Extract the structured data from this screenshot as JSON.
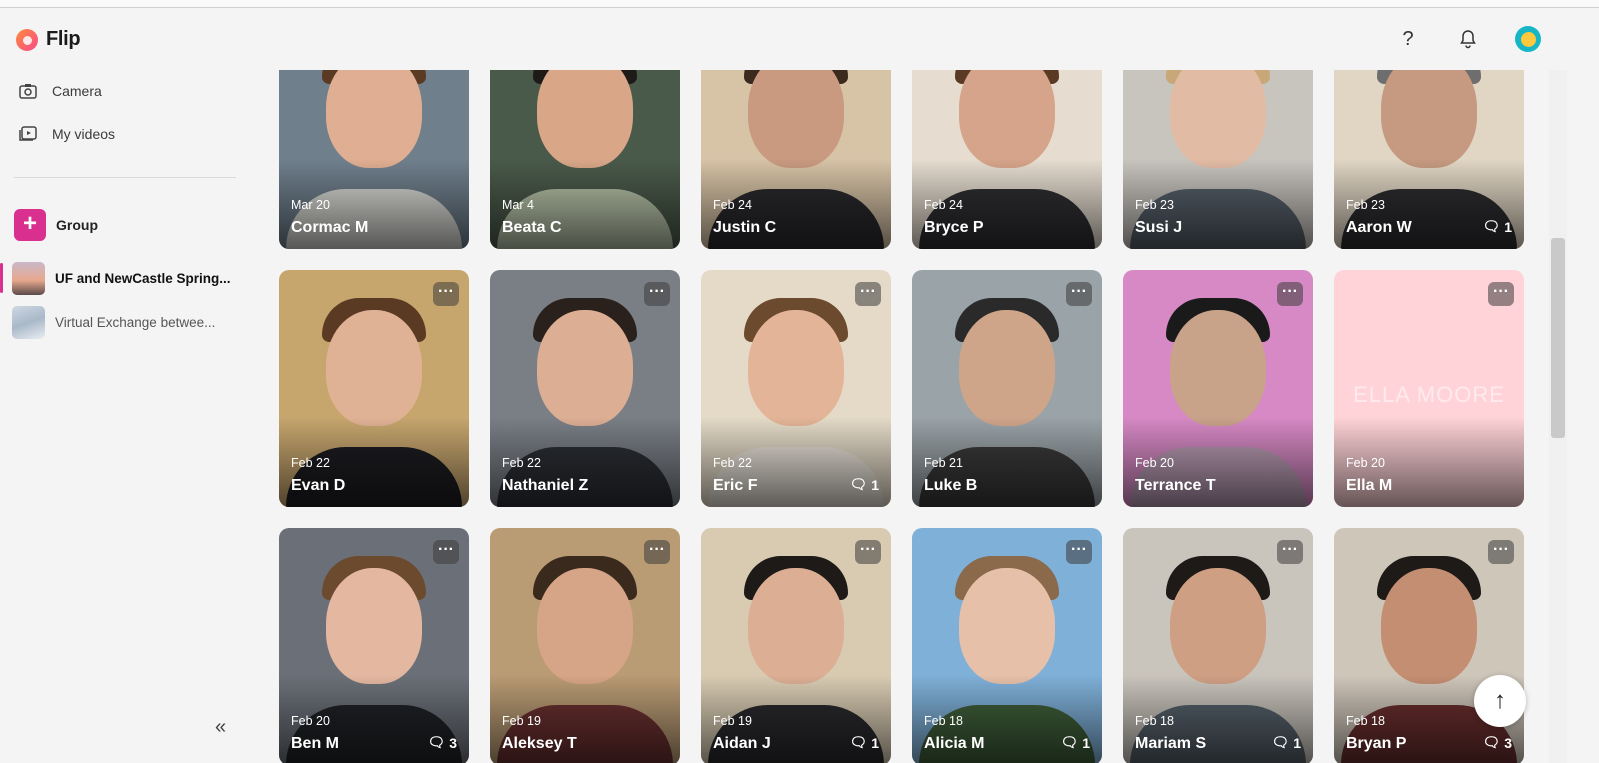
{
  "app": {
    "name": "Flip"
  },
  "header": {
    "help_icon": "question-mark-icon",
    "notifications_icon": "bell-icon",
    "avatar_icon": "emoji-avatar-icon"
  },
  "sidebar": {
    "camera_label": "Camera",
    "my_videos_label": "My videos",
    "group_label": "Group",
    "groups": [
      {
        "label": "UF and NewCastle Spring...",
        "active": true
      },
      {
        "label": "Virtual Exchange betwee...",
        "active": false
      }
    ]
  },
  "colors": {
    "accent": "#d9308f",
    "background": "#f4f4f4"
  },
  "cards": [
    {
      "date": "Mar 20",
      "name": "Cormac M",
      "comments": ""
    },
    {
      "date": "Mar 4",
      "name": "Beata C",
      "comments": ""
    },
    {
      "date": "Feb 24",
      "name": "Justin C",
      "comments": ""
    },
    {
      "date": "Feb 24",
      "name": "Bryce P",
      "comments": ""
    },
    {
      "date": "Feb 23",
      "name": "Susi J",
      "comments": ""
    },
    {
      "date": "Feb 23",
      "name": "Aaron W",
      "comments": "1"
    },
    {
      "date": "Feb 22",
      "name": "Evan D",
      "comments": ""
    },
    {
      "date": "Feb 22",
      "name": "Nathaniel Z",
      "comments": ""
    },
    {
      "date": "Feb 22",
      "name": "Eric F",
      "comments": "1"
    },
    {
      "date": "Feb 21",
      "name": "Luke B",
      "comments": ""
    },
    {
      "date": "Feb 20",
      "name": "Terrance T",
      "comments": ""
    },
    {
      "date": "Feb 20",
      "name": "Ella M",
      "comments": "",
      "overlay": "ELLA MOORE"
    },
    {
      "date": "Feb 20",
      "name": "Ben M",
      "comments": "3"
    },
    {
      "date": "Feb 19",
      "name": "Aleksey T",
      "comments": ""
    },
    {
      "date": "Feb 19",
      "name": "Aidan J",
      "comments": "1"
    },
    {
      "date": "Feb 18",
      "name": "Alicia M",
      "comments": "1"
    },
    {
      "date": "Feb 18",
      "name": "Mariam S",
      "comments": "1"
    },
    {
      "date": "Feb 18",
      "name": "Bryan P",
      "comments": "3"
    }
  ]
}
